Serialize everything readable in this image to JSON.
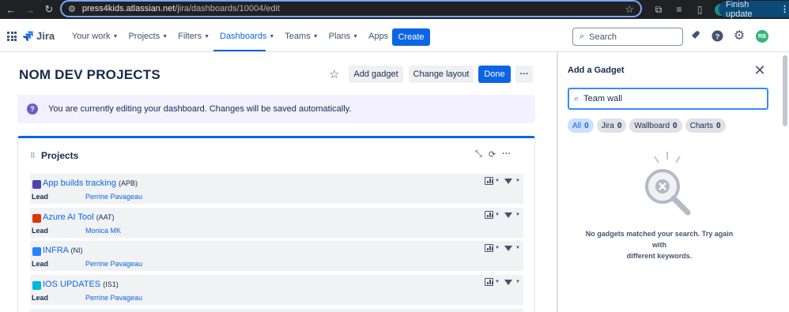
{
  "browser": {
    "url_host": "press4kids.atlassian.net",
    "url_path": "/jira/dashboards/10004/edit",
    "profile_initial": "r",
    "finish_update_label": "Finish update"
  },
  "header": {
    "logo_text": "Jira",
    "nav": [
      {
        "label": "Your work"
      },
      {
        "label": "Projects"
      },
      {
        "label": "Filters"
      },
      {
        "label": "Dashboards"
      },
      {
        "label": "Teams"
      },
      {
        "label": "Plans"
      },
      {
        "label": "Apps"
      }
    ],
    "create_label": "Create",
    "search_placeholder": "Search",
    "avatar_initials": "RB"
  },
  "dashboard": {
    "title": "NOM DEV PROJECTS",
    "add_gadget_label": "Add gadget",
    "change_layout_label": "Change layout",
    "done_label": "Done",
    "more_label": "···",
    "banner_text": "You are currently editing your dashboard. Changes will be saved automatically."
  },
  "projects_gadget": {
    "title": "Projects",
    "lead_label": "Lead",
    "rows": [
      {
        "name": "App builds tracking",
        "key": "(APB)",
        "lead": "Perrine Pavageau",
        "icon_color": "#5243aa"
      },
      {
        "name": "Azure AI Tool",
        "key": "(AAT)",
        "lead": "Monica MK",
        "icon_color": "#de350b"
      },
      {
        "name": "INFRA",
        "key": "(NI)",
        "lead": "Perrine Pavageau",
        "icon_color": "#2684ff"
      },
      {
        "name": "IOS UPDATES",
        "key": "(IS1)",
        "lead": "Perrine Pavageau",
        "icon_color": "#00b8d9"
      }
    ]
  },
  "add_gadget_panel": {
    "title": "Add a Gadget",
    "search_value": "Team wall",
    "filters": [
      {
        "label": "All",
        "count": "0",
        "active": true
      },
      {
        "label": "Jira",
        "count": "0"
      },
      {
        "label": "Wallboard",
        "count": "0"
      },
      {
        "label": "Charts",
        "count": "0"
      }
    ],
    "empty_line1": "No gadgets matched your search. Try again with",
    "empty_line2": "different keywords."
  },
  "colors": {
    "accent": "#0c66e4",
    "banner_bg": "#f3f0ff",
    "chrome_bg": "#202124"
  }
}
